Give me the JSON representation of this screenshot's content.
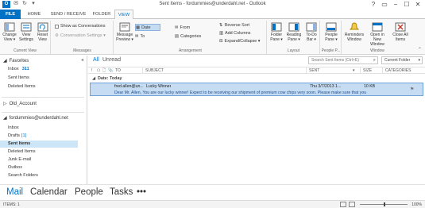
{
  "window": {
    "title": "Sent Items - fordummies@underdahl.net - Outlook",
    "app_icon": "outlook-icon",
    "app_icon_text": "O",
    "controls": [
      "?",
      "▭",
      "−",
      "☐",
      "✕"
    ]
  },
  "qat": [
    "✉",
    "↻",
    "▾"
  ],
  "ribbon_tabs": [
    "FILE",
    "HOME",
    "SEND / RECEIVE",
    "FOLDER",
    "VIEW"
  ],
  "active_tab": "VIEW",
  "ribbon": {
    "current_view": {
      "label": "Current View",
      "change_view": "Change View ▾",
      "view_settings": "View Settings",
      "reset_view": "Reset View"
    },
    "messages": {
      "label": "Messages",
      "show_as_conversations": "Show as Conversations",
      "conversation_settings": "Conversation Settings ▾"
    },
    "arrangement": {
      "label": "Arrangement",
      "message_preview": "Message Preview ▾",
      "items": [
        "Date",
        "From",
        "To",
        "Categories"
      ],
      "selected": "Date",
      "reverse_sort": "Reverse Sort",
      "add_columns": "Add Columns",
      "expand_collapse": "Expand/Collapse ▾"
    },
    "layout": {
      "label": "Layout",
      "folder_pane": "Folder Pane ▾",
      "reading_pane": "Reading Pane ▾",
      "todo_bar": "To-Do Bar ▾"
    },
    "people_pane": {
      "label": "People P...",
      "people_pane": "People Pane ▾"
    },
    "window": {
      "label": "Window",
      "reminders": "Reminders Window",
      "open_new": "Open in New Window",
      "close_all": "Close All Items"
    }
  },
  "folder_pane": {
    "favorites_label": "Favorites",
    "favorites": [
      {
        "name": "Inbox",
        "count": "311"
      },
      {
        "name": "Sent Items",
        "count": ""
      },
      {
        "name": "Deleted Items",
        "count": ""
      }
    ],
    "old_account": "Old_Account",
    "account": "fordummies@underdahl.net",
    "folders": [
      {
        "name": "Inbox",
        "count": ""
      },
      {
        "name": "Drafts",
        "count": "[1]"
      },
      {
        "name": "Sent Items",
        "count": ""
      },
      {
        "name": "Deleted Items",
        "count": ""
      },
      {
        "name": "Junk E-mail",
        "count": ""
      },
      {
        "name": "Outbox",
        "count": ""
      },
      {
        "name": "Search Folders",
        "count": ""
      }
    ],
    "selected": "Sent Items"
  },
  "message_list": {
    "filter_all": "All",
    "filter_unread": "Unread",
    "search_placeholder": "Search Sent Items (Ctrl+E)",
    "scope": "Current Folder",
    "columns": [
      "!",
      "☖",
      "🗋",
      "📎",
      "TO",
      "SUBJECT",
      "SENT",
      "▾",
      "SIZE",
      "CATEGORIES"
    ],
    "group": "Date: Today",
    "messages": [
      {
        "to": "fred.allen@un...",
        "subject": "Lucky Winner",
        "sent": "Thu 3/7/2013 1...",
        "size": "10 KB",
        "preview": "Dear Mr. Allen, You are our lucky winner! Expect to be receiving our shipment of premium cow chips very soon. Please make sure that you"
      }
    ]
  },
  "navigation": [
    "Mail",
    "Calendar",
    "People",
    "Tasks",
    "•••"
  ],
  "active_nav": "Mail",
  "status": {
    "items": "ITEMS: 1",
    "zoom": "100%"
  }
}
